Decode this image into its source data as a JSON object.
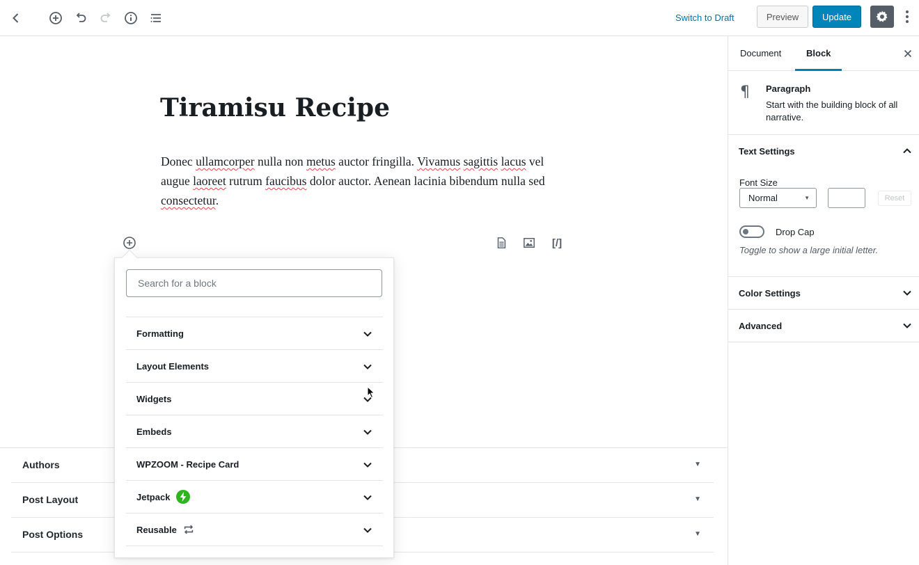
{
  "toolbar": {
    "switch_to_draft": "Switch to Draft",
    "preview": "Preview",
    "update": "Update",
    "icons": [
      "back-chevron-icon",
      "add-block-icon",
      "undo-icon",
      "redo-icon",
      "info-icon",
      "outline-icon",
      "gear-icon",
      "more-vertical-icon"
    ]
  },
  "post": {
    "title": "Tiramisu Recipe",
    "paragraph": {
      "w1": "Donec ",
      "s1": "ullamcorper",
      "w2": " nulla non ",
      "s2": "metus",
      "w3": " auctor fringilla. ",
      "s3": "Vivamus",
      "w4": " ",
      "s4": "sagittis",
      "w5": " ",
      "s5": "lacus",
      "w6": " vel augue ",
      "s6": "laoreet",
      "w7": " rutrum ",
      "s7": "faucibus",
      "w8": " dolor auctor. Aenean lacinia bibendum nulla sed ",
      "s8": "consectetur",
      "w9": "."
    },
    "shortcut_label": "[/]"
  },
  "inserter": {
    "search_placeholder": "Search for a block",
    "categories": [
      {
        "label": "Formatting"
      },
      {
        "label": "Layout Elements"
      },
      {
        "label": "Widgets"
      },
      {
        "label": "Embeds"
      },
      {
        "label": "WPZOOM - Recipe Card"
      },
      {
        "label": "Jetpack",
        "badge": "jetpack-bolt-icon",
        "badge_color": "#2fb41f"
      },
      {
        "label": "Reusable",
        "badge": "reusable-icon"
      }
    ]
  },
  "metaboxes": [
    {
      "title": "Authors"
    },
    {
      "title": "Post Layout"
    },
    {
      "title": "Post Options"
    }
  ],
  "sidebar": {
    "tabs": [
      "Document",
      "Block"
    ],
    "active_tab": "Block",
    "block": {
      "name": "Paragraph",
      "description": "Start with the building block of all narrative."
    },
    "text_settings": {
      "title": "Text Settings",
      "font_size_label": "Font Size",
      "font_size_value": "Normal",
      "reset_label": "Reset",
      "drop_cap_label": "Drop Cap",
      "drop_cap_help": "Toggle to show a large initial letter."
    },
    "color_settings_title": "Color Settings",
    "advanced_title": "Advanced"
  },
  "colors": {
    "accent": "#0085ba",
    "link": "#0073aa",
    "jetpack": "#2fb41f"
  }
}
